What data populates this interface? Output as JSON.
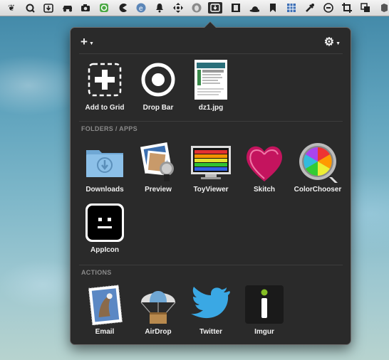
{
  "menubar": {
    "icons": [
      "feather-icon",
      "magnifier-icon",
      "download-box-icon",
      "car-icon",
      "camera-icon",
      "recycle-icon",
      "pacman-icon",
      "e-badge-icon",
      "bell-icon",
      "move-arrows-icon",
      "alien-icon",
      "dropzone-icon",
      "filmstrip-icon",
      "bowler-hat-icon",
      "bookmark-icon",
      "grid-icon",
      "dropper-icon",
      "power-circle-icon",
      "crop-icon",
      "copy-icon",
      "evernote-icon"
    ]
  },
  "toolbar": {
    "add_label": "+",
    "settings_label": "⚙"
  },
  "top_items": [
    {
      "label": "Add to Grid",
      "icon": "add-grid-icon"
    },
    {
      "label": "Drop Bar",
      "icon": "target-icon"
    },
    {
      "label": "dz1.jpg",
      "icon": "image-thumbnail-icon"
    }
  ],
  "folders_section": {
    "title": "FOLDERS / APPS",
    "items": [
      {
        "label": "Downloads",
        "icon": "downloads-folder-icon"
      },
      {
        "label": "Preview",
        "icon": "preview-app-icon"
      },
      {
        "label": "ToyViewer",
        "icon": "toyviewer-app-icon"
      },
      {
        "label": "Skitch",
        "icon": "skitch-app-icon"
      },
      {
        "label": "ColorChooser",
        "icon": "colorchooser-app-icon"
      },
      {
        "label": "AppIcon",
        "icon": "appicon-icon"
      }
    ]
  },
  "actions_section": {
    "title": "ACTIONS",
    "items": [
      {
        "label": "Email",
        "icon": "email-stamp-icon"
      },
      {
        "label": "AirDrop",
        "icon": "airdrop-icon"
      },
      {
        "label": "Twitter",
        "icon": "twitter-bird-icon"
      },
      {
        "label": "Imgur",
        "icon": "imgur-icon"
      }
    ]
  }
}
